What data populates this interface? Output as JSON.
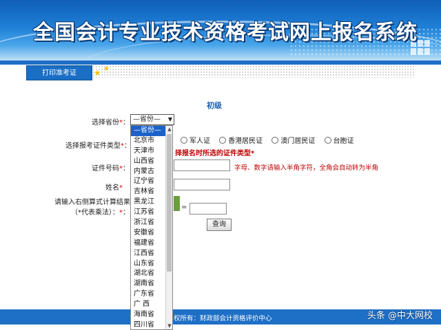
{
  "header": {
    "title": "全国会计专业技术资格考试网上报名系统"
  },
  "tabs": {
    "print_ticket": "打印准考证"
  },
  "form": {
    "level": "初级",
    "province_label": "选择省份",
    "province_selected": "—省份—",
    "id_type_label": "选择报考证件类型",
    "id_types": [
      "军人证",
      "香港居民证",
      "澳门居民证",
      "台胞证"
    ],
    "id_type_note": "择报名时所选的证件类型",
    "id_number_label": "证件号码",
    "id_number_hint": "字母、数字请输入半角字符，全角会自动转为半角",
    "name_label": "姓名",
    "captcha_label_line1": "请输入右侧算式计算结果",
    "captcha_label_line2": "（*代表乘法）：",
    "required_mark": "*",
    "colon": "：",
    "equals": "=",
    "query_button": "查询"
  },
  "province_dropdown": {
    "options": [
      "—省份—",
      "北京市",
      "天津市",
      "山西省",
      "内蒙古",
      "辽宁省",
      "吉林省",
      "黑龙江",
      "江苏省",
      "浙江省",
      "安徽省",
      "福建省",
      "江西省",
      "山东省",
      "湖北省",
      "湖南省",
      "广东省",
      "广 西",
      "海南省",
      "四川省"
    ],
    "selected_index": 0
  },
  "footer": {
    "copyright": "权所有：财政部会计资格评价中心"
  },
  "watermark": {
    "text": "头条 @中大网校"
  },
  "colors": {
    "primary_blue": "#1e6fc6",
    "required_red": "#d00000",
    "hint_red": "#c00000",
    "selection_blue": "#1a62c9"
  }
}
